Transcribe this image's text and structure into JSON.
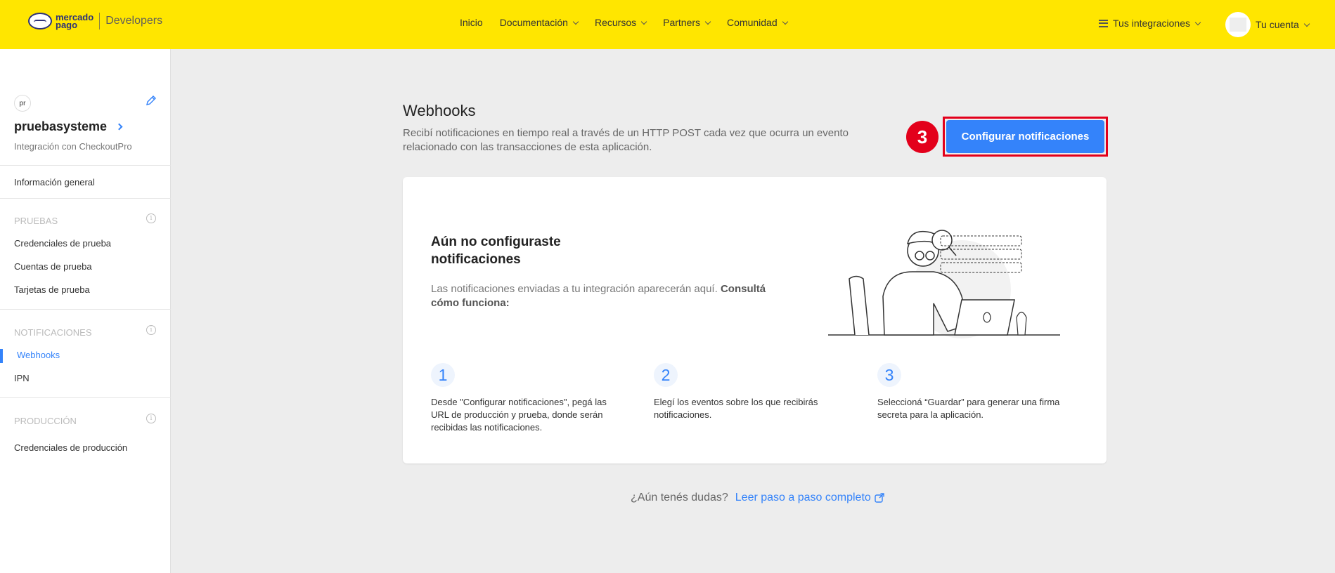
{
  "header": {
    "logo_line1": "mercado",
    "logo_line2": "pago",
    "product": "Developers",
    "nav": [
      "Inicio",
      "Documentación",
      "Recursos",
      "Partners",
      "Comunidad"
    ],
    "integrations_label": "Tus integraciones",
    "account_label": "Tu cuenta",
    "brand_color": "#ffe600"
  },
  "sidebar": {
    "app_initials": "pr",
    "app_name": "pruebasysteme",
    "app_subtitle": "Integración con CheckoutPro",
    "general_info": "Información general",
    "section_tests": "PRUEBAS",
    "tests_items": [
      "Credenciales de prueba",
      "Cuentas de prueba",
      "Tarjetas de prueba"
    ],
    "section_notifications": "NOTIFICACIONES",
    "notifications_items": [
      "Webhooks",
      "IPN"
    ],
    "section_production": "PRODUCCIÓN",
    "production_items": [
      "Credenciales de producción"
    ]
  },
  "main": {
    "title": "Webhooks",
    "description": "Recibí notificaciones en tiempo real a través de un HTTP POST cada vez que ocurra un evento relacionado con las transacciones de esta aplicación.",
    "step_marker": "3",
    "configure_button": "Configurar notificaciones",
    "empty_title": "Aún no configuraste notificaciones",
    "empty_desc": "Las notificaciones enviadas a tu integración aparecerán aquí.",
    "empty_desc_bold": "Consultá cómo funciona:",
    "steps": [
      {
        "num": "1",
        "text": "Desde \"Configurar notificaciones\", pegá las URL de producción y prueba, donde serán recibidas las notificaciones."
      },
      {
        "num": "2",
        "text": "Elegí los eventos sobre los que recibirás notificaciones."
      },
      {
        "num": "3",
        "text": "Seleccioná “Guardar” para generar una firma secreta para la aplicación."
      }
    ],
    "help_question": "¿Aún tenés dudas?",
    "help_link": "Leer paso a paso completo"
  },
  "colors": {
    "accent": "#3483fa",
    "marker": "#e3001b"
  }
}
